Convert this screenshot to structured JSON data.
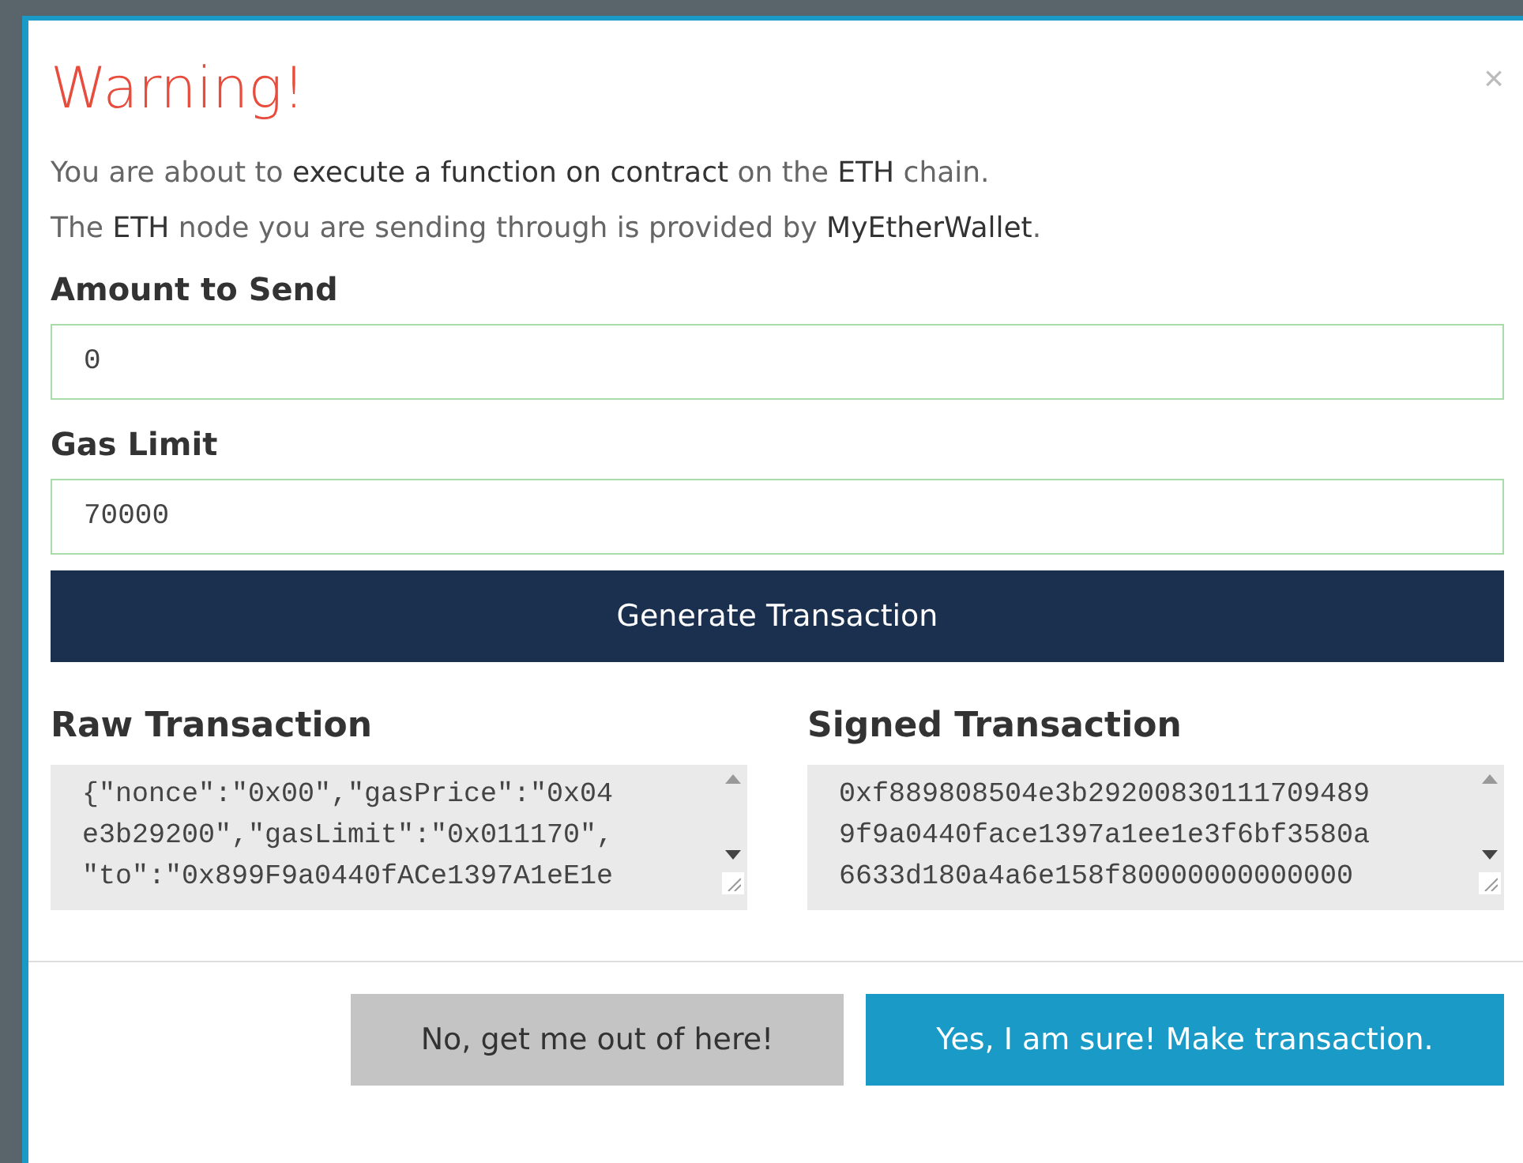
{
  "modal": {
    "title": "Warning!",
    "close": "×",
    "messages": [
      "You are about to **execute a function on contract** on the **ETH** chain.",
      "The **ETH** node you are sending through is provided by **MyEtherWallet**."
    ],
    "fields": [
      {
        "label": "Amount to Send",
        "value": "0"
      },
      {
        "label": "Gas Limit",
        "value": "70000"
      }
    ],
    "generate_button": "Generate Transaction",
    "transactions": [
      {
        "label": "Raw Transaction",
        "lines": [
          "{\"nonce\":\"0x00\",\"gasPrice\":\"0x04",
          "e3b29200\",\"gasLimit\":\"0x011170\",",
          "\"to\":\"0x899F9a0440fACe1397A1eE1e"
        ]
      },
      {
        "label": "Signed Transaction",
        "lines": [
          "0xf889808504e3b29200830111709489",
          "9f9a0440face1397a1ee1e3f6bf3580a",
          "6633d180a4a6e158f80000000000000"
        ]
      }
    ],
    "buttons": [
      {
        "label": "No, get me out of here!",
        "kind": "cancel"
      },
      {
        "label": "Yes, I am sure! Make transaction.",
        "kind": "confirm"
      }
    ]
  }
}
